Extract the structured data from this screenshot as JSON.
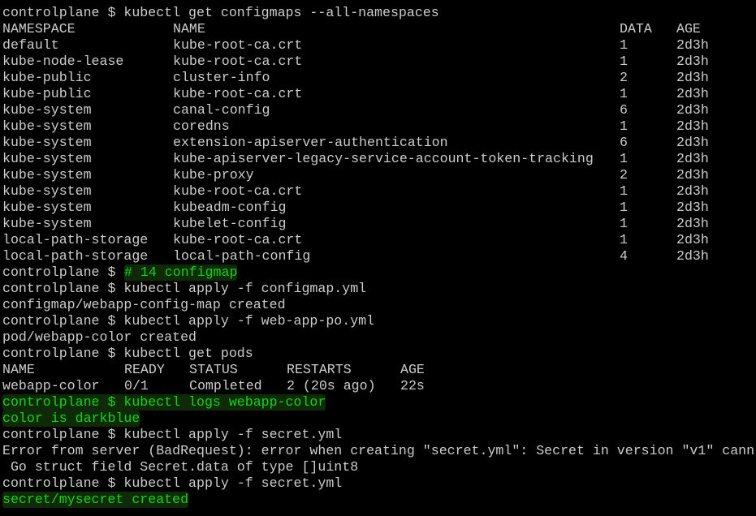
{
  "colors": {
    "background": "#000000",
    "foreground": "#cccccc",
    "highlight_green": "#13d613"
  },
  "cmd1": "controlplane $ kubectl get configmaps --all-namespaces",
  "cm_header": {
    "namespace": "NAMESPACE",
    "name": "NAME",
    "data": "DATA",
    "age": "AGE"
  },
  "configmaps": [
    {
      "namespace": "default",
      "name": "kube-root-ca.crt",
      "data": "1",
      "age": "2d3h"
    },
    {
      "namespace": "kube-node-lease",
      "name": "kube-root-ca.crt",
      "data": "1",
      "age": "2d3h"
    },
    {
      "namespace": "kube-public",
      "name": "cluster-info",
      "data": "2",
      "age": "2d3h"
    },
    {
      "namespace": "kube-public",
      "name": "kube-root-ca.crt",
      "data": "1",
      "age": "2d3h"
    },
    {
      "namespace": "kube-system",
      "name": "canal-config",
      "data": "6",
      "age": "2d3h"
    },
    {
      "namespace": "kube-system",
      "name": "coredns",
      "data": "1",
      "age": "2d3h"
    },
    {
      "namespace": "kube-system",
      "name": "extension-apiserver-authentication",
      "data": "6",
      "age": "2d3h"
    },
    {
      "namespace": "kube-system",
      "name": "kube-apiserver-legacy-service-account-token-tracking",
      "data": "1",
      "age": "2d3h"
    },
    {
      "namespace": "kube-system",
      "name": "kube-proxy",
      "data": "2",
      "age": "2d3h"
    },
    {
      "namespace": "kube-system",
      "name": "kube-root-ca.crt",
      "data": "1",
      "age": "2d3h"
    },
    {
      "namespace": "kube-system",
      "name": "kubeadm-config",
      "data": "1",
      "age": "2d3h"
    },
    {
      "namespace": "kube-system",
      "name": "kubelet-config",
      "data": "1",
      "age": "2d3h"
    },
    {
      "namespace": "local-path-storage",
      "name": "kube-root-ca.crt",
      "data": "1",
      "age": "2d3h"
    },
    {
      "namespace": "local-path-storage",
      "name": "local-path-config",
      "data": "4",
      "age": "2d3h"
    }
  ],
  "comment_prompt": "controlplane $ ",
  "comment_text": "# 14 configmap",
  "cmd2": "controlplane $ kubectl apply -f configmap.yml",
  "out2": "configmap/webapp-config-map created",
  "cmd3": "controlplane $ kubectl apply -f web-app-po.yml",
  "out3": "pod/webapp-color created",
  "cmd4": "controlplane $ kubectl get pods",
  "pods_header": {
    "name": "NAME",
    "ready": "READY",
    "status": "STATUS",
    "restarts": "RESTARTS",
    "age": "AGE"
  },
  "pod": {
    "name": "webapp-color",
    "ready": "0/1",
    "status": "Completed",
    "restarts": "2 (20s ago)",
    "age": "22s"
  },
  "cmd5": "controlplane $ kubectl logs webapp-color",
  "out5": "color is darkblue",
  "cmd6": "controlplane $ kubectl apply -f secret.yml",
  "err1": "Error from server (BadRequest): error when creating \"secret.yml\": Secret in version \"v1\" cann",
  "err2": " Go struct field Secret.data of type []uint8",
  "cmd7": "controlplane $ kubectl apply -f secret.yml",
  "out7": "secret/mysecret created"
}
